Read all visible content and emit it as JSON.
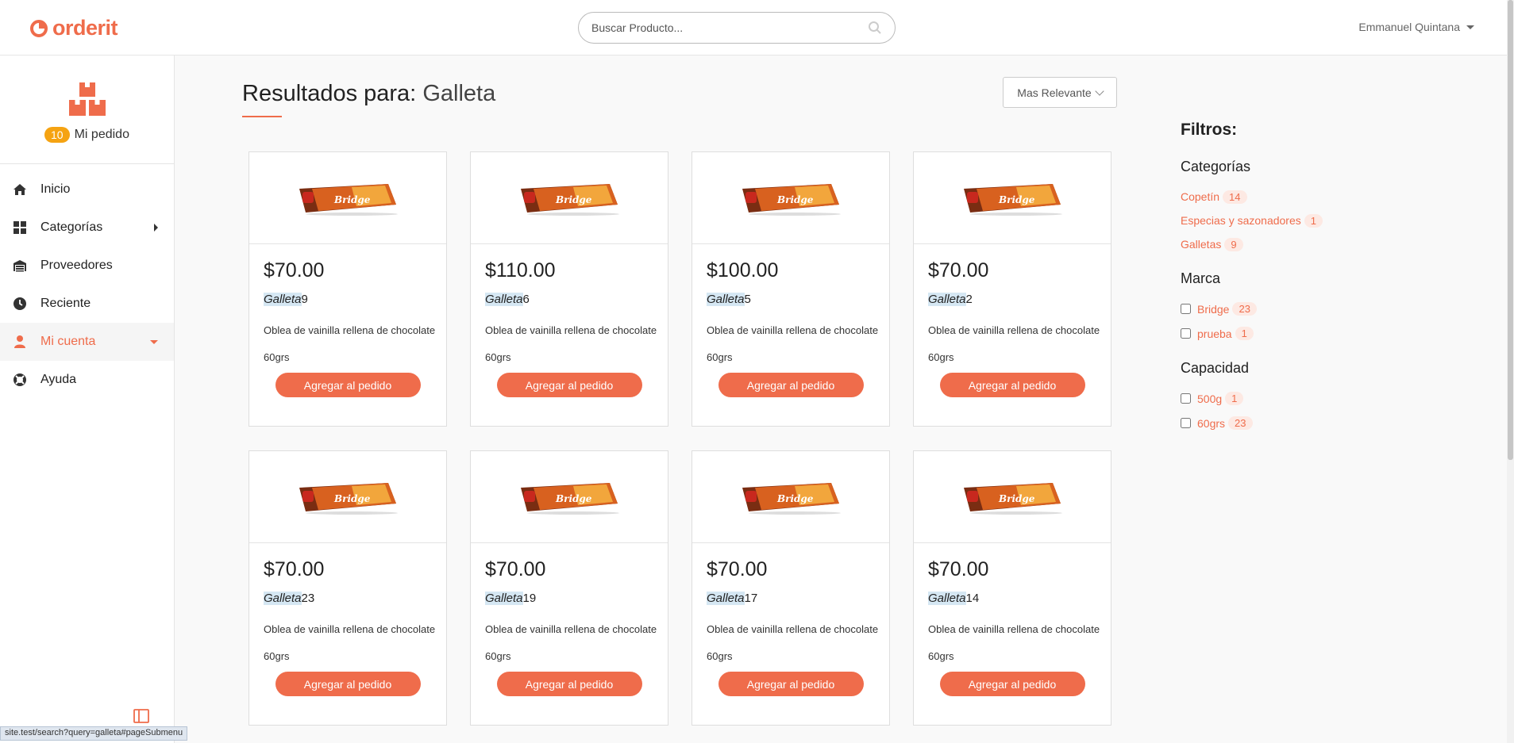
{
  "brand": {
    "name": "orderit",
    "accent": "#ef6c4b"
  },
  "search": {
    "placeholder": "Buscar Producto...",
    "value": ""
  },
  "user": {
    "name": "Emmanuel Quintana"
  },
  "order": {
    "count": "10",
    "label": "Mi pedido"
  },
  "sidebar": {
    "items": [
      {
        "label": "Inicio",
        "icon": "home-icon"
      },
      {
        "label": "Categorías",
        "icon": "grid-icon"
      },
      {
        "label": "Proveedores",
        "icon": "warehouse-icon"
      },
      {
        "label": "Reciente",
        "icon": "clock-icon"
      },
      {
        "label": "Mi cuenta",
        "icon": "user-icon"
      },
      {
        "label": "Ayuda",
        "icon": "lifebuoy-icon"
      }
    ]
  },
  "results": {
    "prefix": "Resultados para:",
    "query": "Galleta"
  },
  "sort": {
    "selected": "Mas Relevante"
  },
  "products": [
    {
      "price": "$70.00",
      "name_hl": "Galleta",
      "name_rest": "9",
      "desc": "Oblea de vainilla rellena de chocolate",
      "size": "60grs",
      "button": "Agregar al pedido"
    },
    {
      "price": "$110.00",
      "name_hl": "Galleta",
      "name_rest": "6",
      "desc": "Oblea de vainilla rellena de chocolate",
      "size": "60grs",
      "button": "Agregar al pedido"
    },
    {
      "price": "$100.00",
      "name_hl": "Galleta",
      "name_rest": "5",
      "desc": "Oblea de vainilla rellena de chocolate",
      "size": "60grs",
      "button": "Agregar al pedido"
    },
    {
      "price": "$70.00",
      "name_hl": "Galleta",
      "name_rest": "2",
      "desc": "Oblea de vainilla rellena de chocolate",
      "size": "60grs",
      "button": "Agregar al pedido"
    },
    {
      "price": "$70.00",
      "name_hl": "Galleta",
      "name_rest": "23",
      "desc": "Oblea de vainilla rellena de chocolate",
      "size": "60grs",
      "button": "Agregar al pedido"
    },
    {
      "price": "$70.00",
      "name_hl": "Galleta",
      "name_rest": "19",
      "desc": "Oblea de vainilla rellena de chocolate",
      "size": "60grs",
      "button": "Agregar al pedido"
    },
    {
      "price": "$70.00",
      "name_hl": "Galleta",
      "name_rest": "17",
      "desc": "Oblea de vainilla rellena de chocolate",
      "size": "60grs",
      "button": "Agregar al pedido"
    },
    {
      "price": "$70.00",
      "name_hl": "Galleta",
      "name_rest": "14",
      "desc": "Oblea de vainilla rellena de chocolate",
      "size": "60grs",
      "button": "Agregar al pedido"
    }
  ],
  "product_image_text": "Bridge",
  "filters": {
    "title": "Filtros:",
    "categories": {
      "title": "Categorías",
      "items": [
        {
          "label": "Copetín",
          "count": "14"
        },
        {
          "label": "Especias y sazonadores",
          "count": "1"
        },
        {
          "label": "Galletas",
          "count": "9"
        }
      ]
    },
    "brand": {
      "title": "Marca",
      "items": [
        {
          "label": "Bridge",
          "count": "23"
        },
        {
          "label": "prueba",
          "count": "1"
        }
      ]
    },
    "capacity": {
      "title": "Capacidad",
      "items": [
        {
          "label": "500g",
          "count": "1"
        },
        {
          "label": "60grs",
          "count": "23"
        }
      ]
    }
  },
  "status_url": "site.test/search?query=galleta#pageSubmenu"
}
